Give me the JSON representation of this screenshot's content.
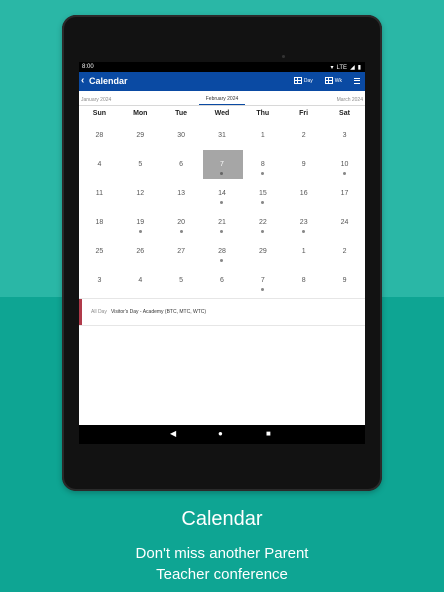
{
  "statusbar": {
    "time": "8:00",
    "network": "LTE"
  },
  "appbar": {
    "title": "Calendar",
    "back_icon": "back-arrow-icon",
    "view_icon_1_label": "Day",
    "view_icon_2_label": "Wk"
  },
  "monthnav": {
    "prev": "January 2024",
    "current": "February 2024",
    "next": "March 2024"
  },
  "weekdays": [
    "Sun",
    "Mon",
    "Tue",
    "Wed",
    "Thu",
    "Fri",
    "Sat"
  ],
  "weeks": [
    [
      {
        "d": "28"
      },
      {
        "d": "29"
      },
      {
        "d": "30"
      },
      {
        "d": "31"
      },
      {
        "d": "1"
      },
      {
        "d": "2"
      },
      {
        "d": "3"
      }
    ],
    [
      {
        "d": "4"
      },
      {
        "d": "5"
      },
      {
        "d": "6"
      },
      {
        "d": "7",
        "dot": true,
        "selected": true
      },
      {
        "d": "8",
        "dot": true
      },
      {
        "d": "9"
      },
      {
        "d": "10",
        "dot": true
      }
    ],
    [
      {
        "d": "11"
      },
      {
        "d": "12"
      },
      {
        "d": "13"
      },
      {
        "d": "14",
        "dot": true
      },
      {
        "d": "15",
        "dot": true
      },
      {
        "d": "16"
      },
      {
        "d": "17"
      }
    ],
    [
      {
        "d": "18"
      },
      {
        "d": "19",
        "dot": true
      },
      {
        "d": "20",
        "dot": true
      },
      {
        "d": "21",
        "dot": true
      },
      {
        "d": "22",
        "dot": true
      },
      {
        "d": "23",
        "dot": true
      },
      {
        "d": "24"
      }
    ],
    [
      {
        "d": "25"
      },
      {
        "d": "26"
      },
      {
        "d": "27"
      },
      {
        "d": "28",
        "dot": true
      },
      {
        "d": "29"
      },
      {
        "d": "1"
      },
      {
        "d": "2"
      }
    ],
    [
      {
        "d": "3"
      },
      {
        "d": "4"
      },
      {
        "d": "5"
      },
      {
        "d": "6"
      },
      {
        "d": "7",
        "dot": true
      },
      {
        "d": "8"
      },
      {
        "d": "9"
      }
    ]
  ],
  "event": {
    "all_day": "All Day",
    "title": "Visitor's Day - Academy (BTC, MTC, WTC)",
    "color": "#b03a4a"
  },
  "navbar": {
    "back": "◀",
    "home": "●",
    "recents": "■"
  },
  "caption": {
    "title": "Calendar",
    "subtitle_line1": "Don't miss another Parent",
    "subtitle_line2": "Teacher conference"
  },
  "colors": {
    "appbar": "#0a4aa3",
    "background_top": "#2ab7a6",
    "background_bottom": "#0ea593",
    "selected_day": "#a6a6a6"
  }
}
